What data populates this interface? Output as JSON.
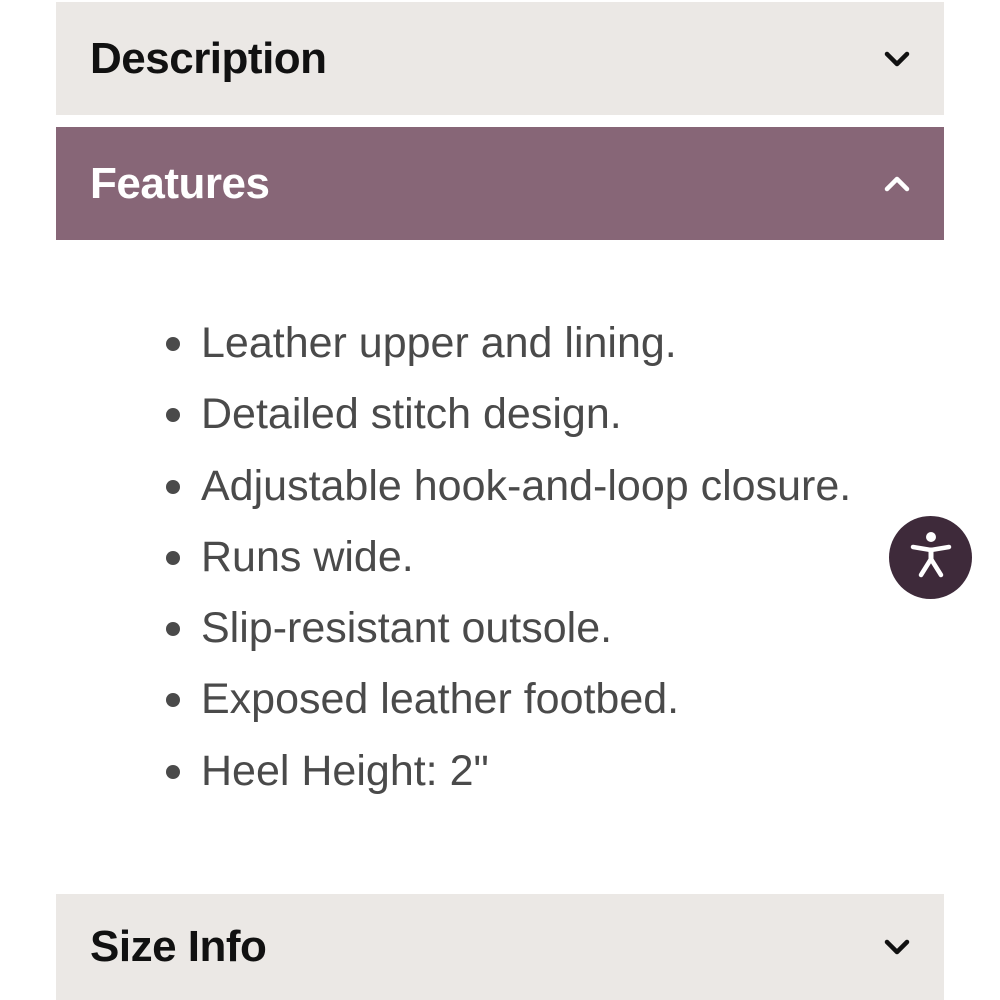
{
  "accordion": {
    "description": {
      "title": "Description",
      "state": "collapsed",
      "icon": "chevron-down-icon"
    },
    "features": {
      "title": "Features",
      "state": "expanded",
      "icon": "chevron-up-icon",
      "items": [
        "Leather upper and lining.",
        "Detailed stitch design.",
        "Adjustable hook-and-loop closure.",
        "Runs wide.",
        "Slip-resistant outsole.",
        "Exposed leather footbed.",
        "Heel Height: 2\""
      ]
    },
    "size_info": {
      "title": "Size Info",
      "state": "collapsed",
      "icon": "chevron-down-icon"
    }
  },
  "accessibility_button": {
    "icon": "accessibility-icon"
  },
  "colors": {
    "closed_header_bg": "#ebe8e5",
    "open_header_bg": "#876677",
    "accessibility_bg": "#3e2a3a",
    "body_text": "#4a4a4a"
  }
}
